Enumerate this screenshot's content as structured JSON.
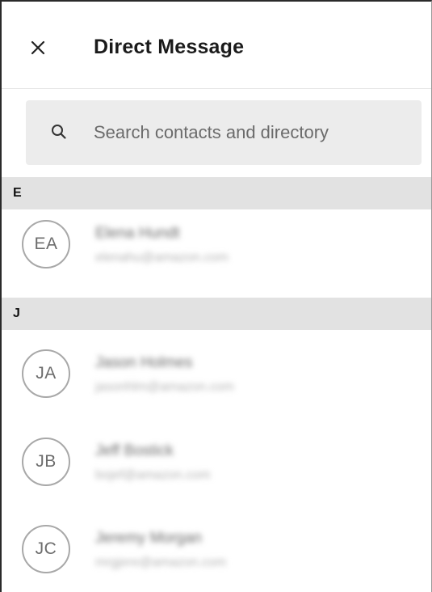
{
  "header": {
    "title": "Direct Message",
    "close_icon": "close-icon"
  },
  "search": {
    "placeholder": "Search contacts and directory",
    "icon": "search-icon"
  },
  "sections": [
    {
      "letter": "E",
      "contacts": [
        {
          "initials": "EA",
          "name": "Elena Hundt",
          "email": "elenahu@amazon.com"
        }
      ]
    },
    {
      "letter": "J",
      "contacts": [
        {
          "initials": "JA",
          "name": "Jason Holmes",
          "email": "jasonhlm@amazon.com"
        },
        {
          "initials": "JB",
          "name": "Jeff Bostick",
          "email": "bojef@amazon.com"
        },
        {
          "initials": "JC",
          "name": "Jeremy Morgan",
          "email": "mrgjere@amazon.com"
        }
      ]
    }
  ],
  "colors": {
    "section_bg": "#e2e2e2",
    "search_bg": "#ececec",
    "avatar_border": "#a8a8a8"
  }
}
